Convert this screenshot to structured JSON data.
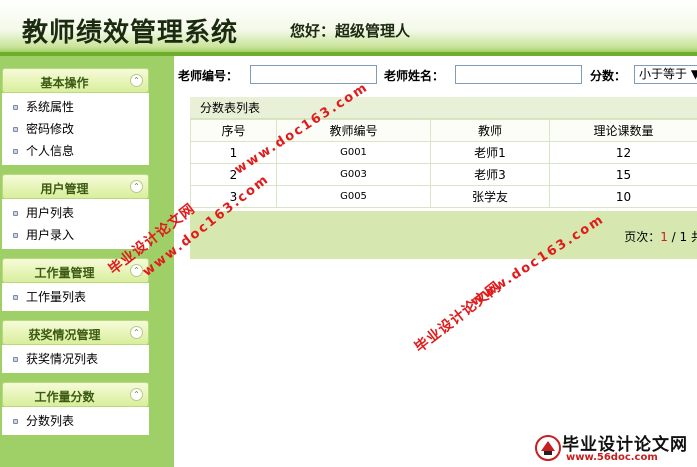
{
  "header": {
    "title": "教师绩效管理系统",
    "greeting": "您好：超级管理人"
  },
  "sidebar": {
    "groups": [
      {
        "title": "基本操作",
        "items": [
          "系统属性",
          "密码修改",
          "个人信息"
        ]
      },
      {
        "title": "用户管理",
        "items": [
          "用户列表",
          "用户录入"
        ]
      },
      {
        "title": "工作量管理",
        "items": [
          "工作量列表"
        ]
      },
      {
        "title": "获奖情况管理",
        "items": [
          "获奖情况列表"
        ]
      },
      {
        "title": "工作量分数",
        "items": [
          "分数列表"
        ]
      }
    ],
    "collapse_glyph": "⌃"
  },
  "search": {
    "teacher_no_label": "老师编号：",
    "teacher_no_value": "",
    "teacher_name_label": "老师姓名：",
    "teacher_name_value": "",
    "score_label": "分数：",
    "score_select_value": "小于等于 ▼"
  },
  "panel": {
    "title": "分数表列表",
    "columns": [
      "序号",
      "教师编号",
      "教师",
      "理论课数量"
    ],
    "rows": [
      {
        "index": "1",
        "code": "G001",
        "teacher": "老师1",
        "count": "12"
      },
      {
        "index": "2",
        "code": "G003",
        "teacher": "老师3",
        "count": "15"
      },
      {
        "index": "3",
        "code": "G005",
        "teacher": "张学友",
        "count": "10"
      }
    ]
  },
  "pager": {
    "label": "页次：",
    "current": "1",
    "separator": " / ",
    "total": "1",
    "tail": " 共"
  },
  "watermarks": {
    "text": "毕业设计论文网",
    "url": "www.doc163.com"
  },
  "logo": {
    "text": "毕业设计论文网",
    "url": "www.56doc.com"
  },
  "colors": {
    "accent": "#6fae2c",
    "sidebar": "#9fd068",
    "watermark": "#e11b1b"
  }
}
